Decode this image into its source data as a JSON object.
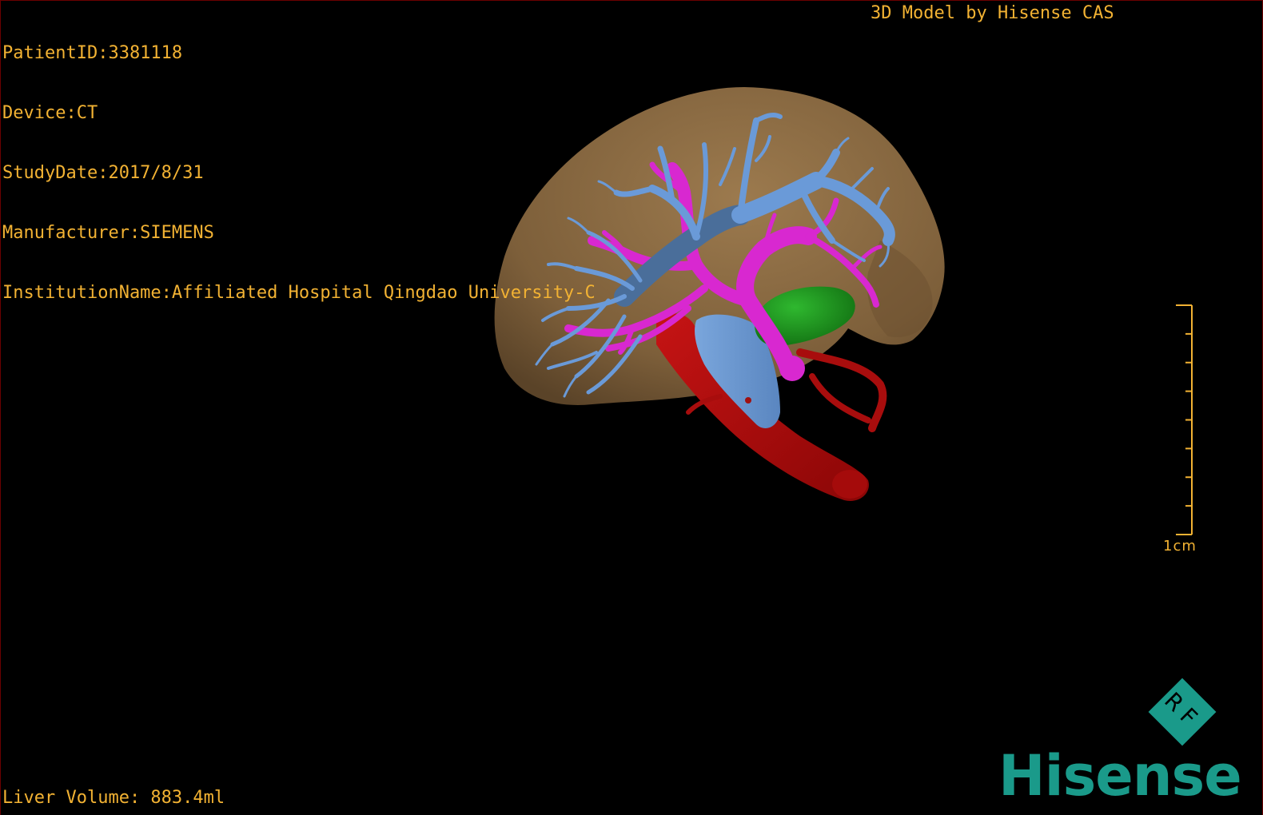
{
  "info": {
    "patient_id": "PatientID:3381118",
    "device": "Device:CT",
    "study_date": "StudyDate:2017/8/31",
    "manufacturer": "Manufacturer:SIEMENS",
    "institution": "InstitutionName:Affiliated Hospital Qingdao University-C"
  },
  "credit": "3D Model by Hisense CAS",
  "volume": "Liver Volume: 883.4ml",
  "scale": {
    "label": "1cm",
    "ticks": 9
  },
  "logo": {
    "mark_letters": "RF",
    "word": "Hisense"
  },
  "colors": {
    "overlay_text": "#f2b233",
    "liver": "#8a6a42",
    "hepatic_vein": "#6a9ad8",
    "portal_vein": "#e22ad8",
    "artery_ivc": "#b80f0f",
    "gallbladder": "#1f9a1f",
    "logo": "#1a9a8a"
  },
  "icons": {
    "logo_mark": "rf-diamond-icon"
  }
}
